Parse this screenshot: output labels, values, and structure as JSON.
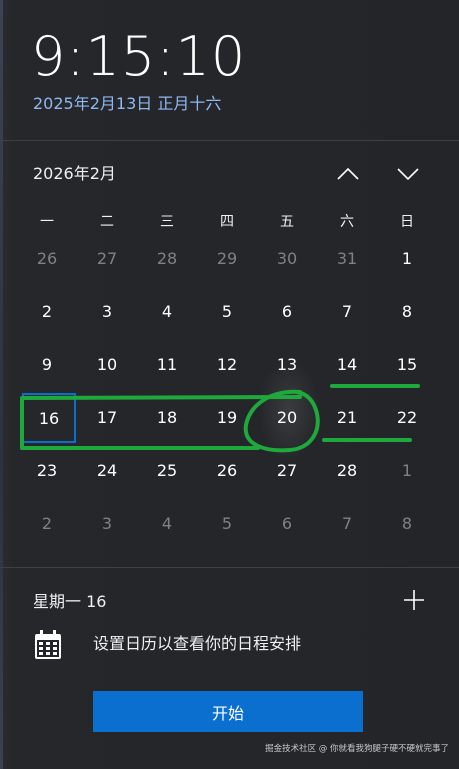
{
  "clock": {
    "time": "9:15:10",
    "date": "2025年2月13日 正月十六"
  },
  "calendar": {
    "month_title": "2026年2月",
    "weekdays": [
      "一",
      "二",
      "三",
      "四",
      "五",
      "六",
      "日"
    ],
    "weeks": [
      [
        {
          "d": "26",
          "dim": true
        },
        {
          "d": "27",
          "dim": true
        },
        {
          "d": "28",
          "dim": true
        },
        {
          "d": "29",
          "dim": true
        },
        {
          "d": "30",
          "dim": true
        },
        {
          "d": "31",
          "dim": true
        },
        {
          "d": "1",
          "dim": false
        }
      ],
      [
        {
          "d": "2",
          "dim": false
        },
        {
          "d": "3",
          "dim": false
        },
        {
          "d": "4",
          "dim": false
        },
        {
          "d": "5",
          "dim": false
        },
        {
          "d": "6",
          "dim": false
        },
        {
          "d": "7",
          "dim": false
        },
        {
          "d": "8",
          "dim": false
        }
      ],
      [
        {
          "d": "9",
          "dim": false
        },
        {
          "d": "10",
          "dim": false
        },
        {
          "d": "11",
          "dim": false
        },
        {
          "d": "12",
          "dim": false
        },
        {
          "d": "13",
          "dim": false
        },
        {
          "d": "14",
          "dim": false
        },
        {
          "d": "15",
          "dim": false
        }
      ],
      [
        {
          "d": "16",
          "dim": false,
          "today": true
        },
        {
          "d": "17",
          "dim": false
        },
        {
          "d": "18",
          "dim": false
        },
        {
          "d": "19",
          "dim": false
        },
        {
          "d": "20",
          "dim": false
        },
        {
          "d": "21",
          "dim": false
        },
        {
          "d": "22",
          "dim": false
        }
      ],
      [
        {
          "d": "23",
          "dim": false
        },
        {
          "d": "24",
          "dim": false
        },
        {
          "d": "25",
          "dim": false
        },
        {
          "d": "26",
          "dim": false
        },
        {
          "d": "27",
          "dim": false
        },
        {
          "d": "28",
          "dim": false
        },
        {
          "d": "1",
          "dim": true
        }
      ],
      [
        {
          "d": "2",
          "dim": true
        },
        {
          "d": "3",
          "dim": true
        },
        {
          "d": "4",
          "dim": true
        },
        {
          "d": "5",
          "dim": true
        },
        {
          "d": "6",
          "dim": true
        },
        {
          "d": "7",
          "dim": true
        },
        {
          "d": "8",
          "dim": true
        }
      ]
    ]
  },
  "agenda": {
    "selected_date": "星期一 16",
    "hint": "设置日历以查看你的日程安排",
    "start_label": "开始"
  },
  "watermark": "掘金技术社区 @ 你就看我狗腿子硬不硬就完事了",
  "colors": {
    "accent": "#0b6fcf",
    "annotation": "#1fa83c",
    "date_text": "#8fb8f2"
  },
  "icons": {
    "prev": "chevron-up-icon",
    "next": "chevron-down-icon",
    "add": "plus-icon",
    "calendar": "calendar-icon"
  }
}
